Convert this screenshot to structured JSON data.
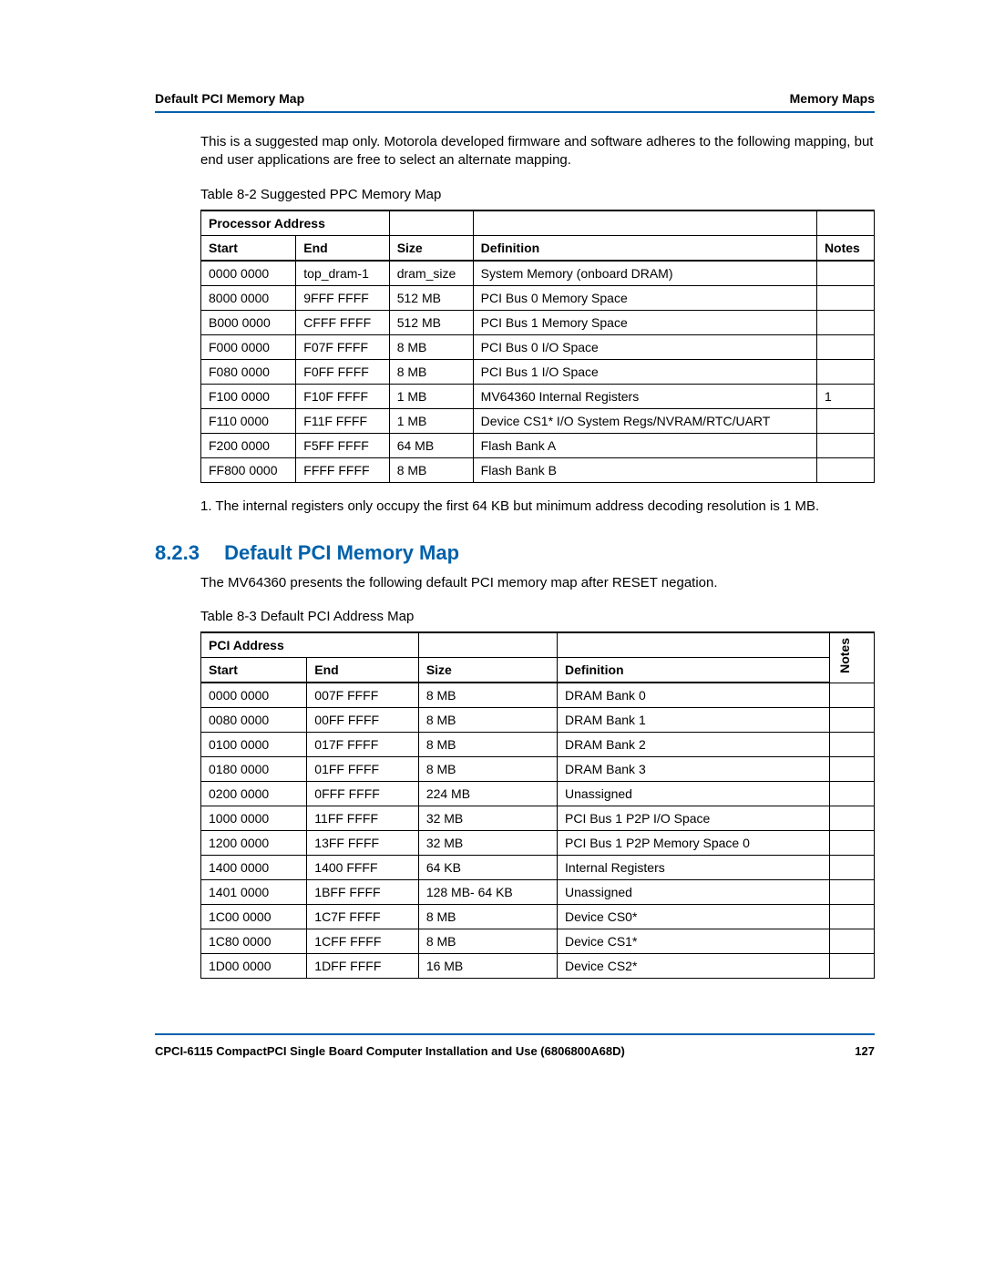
{
  "header": {
    "left": "Default PCI Memory Map",
    "right": "Memory Maps"
  },
  "intro": "This is a suggested map only. Motorola developed firmware and software adheres to the following mapping, but end user applications are free to select an alternate mapping.",
  "table1": {
    "caption": "Table 8-2 Suggested PPC Memory Map",
    "group_header": "Processor Address",
    "cols": {
      "start": "Start",
      "end": "End",
      "size": "Size",
      "definition": "Definition",
      "notes": "Notes"
    },
    "rows": [
      {
        "start": "0000 0000",
        "end": "top_dram-1",
        "size": "dram_size",
        "def": "System Memory (onboard DRAM)",
        "notes": ""
      },
      {
        "start": "8000 0000",
        "end": "9FFF FFFF",
        "size": "512 MB",
        "def": "PCI Bus 0 Memory Space",
        "notes": ""
      },
      {
        "start": "B000 0000",
        "end": "CFFF FFFF",
        "size": "512 MB",
        "def": "PCI Bus 1 Memory Space",
        "notes": ""
      },
      {
        "start": "F000 0000",
        "end": "F07F FFFF",
        "size": "8 MB",
        "def": "PCI Bus 0 I/O Space",
        "notes": ""
      },
      {
        "start": "F080 0000",
        "end": "F0FF FFFF",
        "size": "8 MB",
        "def": "PCI Bus 1 I/O Space",
        "notes": ""
      },
      {
        "start": "F100 0000",
        "end": "F10F FFFF",
        "size": "1 MB",
        "def": "MV64360 Internal Registers",
        "notes": "1"
      },
      {
        "start": "F110 0000",
        "end": "F11F FFFF",
        "size": "1 MB",
        "def": "Device CS1* I/O System Regs/NVRAM/RTC/UART",
        "notes": ""
      },
      {
        "start": "F200 0000",
        "end": "F5FF FFFF",
        "size": "64 MB",
        "def": "Flash Bank A",
        "notes": ""
      },
      {
        "start": "FF800 0000",
        "end": "FFFF FFFF",
        "size": "8 MB",
        "def": "Flash Bank B",
        "notes": ""
      }
    ]
  },
  "footnote1": "1. The internal registers only occupy the first 64 KB but minimum address decoding resolution is 1 MB.",
  "section": {
    "num": "8.2.3",
    "title": "Default PCI Memory Map",
    "text": "The MV64360 presents the following default PCI memory map after RESET negation."
  },
  "table2": {
    "caption": "Table 8-3 Default PCI Address Map",
    "group_header": "PCI Address",
    "cols": {
      "start": "Start",
      "end": "End",
      "size": "Size",
      "definition": "Definition",
      "notes": "Notes"
    },
    "rows": [
      {
        "start": "0000 0000",
        "end": "007F FFFF",
        "size": "8 MB",
        "def": "DRAM Bank 0",
        "notes": ""
      },
      {
        "start": "0080 0000",
        "end": "00FF FFFF",
        "size": "8 MB",
        "def": "DRAM Bank 1",
        "notes": ""
      },
      {
        "start": "0100 0000",
        "end": "017F FFFF",
        "size": "8 MB",
        "def": "DRAM Bank 2",
        "notes": ""
      },
      {
        "start": "0180 0000",
        "end": "01FF FFFF",
        "size": "8 MB",
        "def": "DRAM Bank 3",
        "notes": ""
      },
      {
        "start": "0200 0000",
        "end": "0FFF FFFF",
        "size": "224 MB",
        "def": "Unassigned",
        "notes": ""
      },
      {
        "start": "1000 0000",
        "end": "11FF FFFF",
        "size": "32 MB",
        "def": "PCI Bus 1 P2P I/O Space",
        "notes": ""
      },
      {
        "start": "1200 0000",
        "end": "13FF FFFF",
        "size": "32 MB",
        "def": "PCI Bus 1 P2P Memory Space 0",
        "notes": ""
      },
      {
        "start": "1400 0000",
        "end": "1400 FFFF",
        "size": "64 KB",
        "def": "Internal Registers",
        "notes": ""
      },
      {
        "start": "1401 0000",
        "end": "1BFF FFFF",
        "size": "128 MB- 64 KB",
        "def": "Unassigned",
        "notes": ""
      },
      {
        "start": "1C00 0000",
        "end": "1C7F FFFF",
        "size": "8 MB",
        "def": "Device CS0*",
        "notes": ""
      },
      {
        "start": "1C80 0000",
        "end": "1CFF FFFF",
        "size": "8 MB",
        "def": "Device CS1*",
        "notes": ""
      },
      {
        "start": "1D00 0000",
        "end": "1DFF FFFF",
        "size": "16 MB",
        "def": "Device CS2*",
        "notes": ""
      }
    ]
  },
  "footer": {
    "left": "CPCI-6115 CompactPCI Single Board Computer Installation and Use (6806800A68D)",
    "right": "127"
  }
}
